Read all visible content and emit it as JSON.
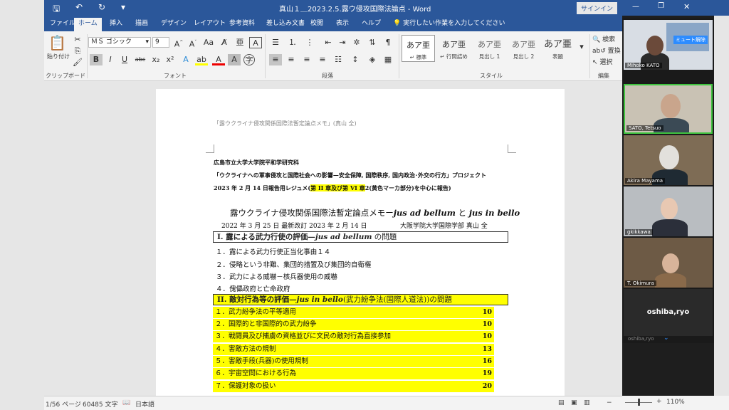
{
  "window": {
    "title": "真山１＿2023.2.5.露ウ侵攻国際法論点 - Word",
    "signin": "サインイン"
  },
  "tabs": [
    "ファイル",
    "ホーム",
    "挿入",
    "描画",
    "デザイン",
    "レイアウト",
    "参考資料",
    "差し込み文書",
    "校閲",
    "表示",
    "ヘルプ"
  ],
  "tell_me": "実行したい作業を入力してください",
  "ribbon": {
    "paste_label": "貼り付け",
    "clipboard_label": "クリップボード",
    "font_name": "ＭＳ ゴシック",
    "font_size": "9",
    "font_group": "フォント",
    "paragraph_group": "段落",
    "style_group": "スタイル",
    "edit_group": "編集",
    "styles": [
      {
        "sample": "あア亜",
        "name": "↵ 標準"
      },
      {
        "sample": "あア亜",
        "name": "↵ 行間詰め"
      },
      {
        "sample": "あア亜",
        "name": "見出し 1"
      },
      {
        "sample": "あア亜",
        "name": "見出し 2"
      },
      {
        "sample": "あア亜",
        "name": "表題"
      }
    ],
    "find": "検索",
    "replace": "置換",
    "select": "選択"
  },
  "document": {
    "header": "「露ウクライナ侵攻関係国際法暫定論点メモ」(真山 全)",
    "line1": "広島市立大学大学院平和学研究科",
    "line2": "「ウクライナへの軍事侵攻と国際社会への影響—安全保障, 国際秩序, 国内政治･外交の行方」プロジェクト",
    "line3a": "2023 年 2 月 14 日報告用レジュメ(",
    "line3b": "第 II 章及び第 VI 章",
    "line3c": "2(黄色マーカ部分)を中心に報告)",
    "title_a": "露ウクライナ侵攻関係国際法暫定論点メモー",
    "title_b": "jus ad bellum",
    "title_c": " と ",
    "title_d": "jus in bello",
    "date_line": "2022 年 3 月 25 日  最新改訂 2023 年 2 月 14 日",
    "author": "大阪学院大学国際学部    真山 全",
    "sec1_a": "I.  露による武力行使の評価—",
    "sec1_b": "jus ad bellum",
    "sec1_c": " の問題",
    "sec1_items": [
      "１．露による武力行使正当化事由１４",
      "２．侵略という非難、集団的措置及び集団的自衛権",
      "３．武力による威嚇－核兵器使用の威嚇",
      "４．傀儡政府と亡命政府"
    ],
    "sec2_a": "II.  敵対行為等の評価—",
    "sec2_b": "jus in bello",
    "sec2_c": "(武力紛争法(国際人道法))の問題",
    "sec2_items": [
      {
        "text": "１．武力紛争法の平等適用",
        "page": "10"
      },
      {
        "text": "２．国際的と非国際的の武力紛争",
        "page": "10"
      },
      {
        "text": "３．戦闘員及び捕虜の資格並びに文民の敵対行為直接参加",
        "page": "10"
      },
      {
        "text": "４．害敵方法の規制",
        "page": "13"
      },
      {
        "text": "５．害敵手段(兵器)の使用規制",
        "page": "16"
      },
      {
        "text": "６．宇宙空間における行為",
        "page": "19"
      },
      {
        "text": "７．保護対象の扱い",
        "page": "20"
      }
    ]
  },
  "status": {
    "page": "1/56 ページ",
    "words": "60485 文字",
    "lang": "日本語",
    "zoom": "110%"
  },
  "zoom_panel": {
    "mute_all": "ミュート解除",
    "participants": [
      "Mihoko KATO",
      "SATO, Tetsuo",
      "Akira Mayama",
      "gkikkawa",
      "T. Okimura"
    ],
    "speaker": "oshiba,ryo",
    "speaker_small": "oshiba,ryo"
  }
}
